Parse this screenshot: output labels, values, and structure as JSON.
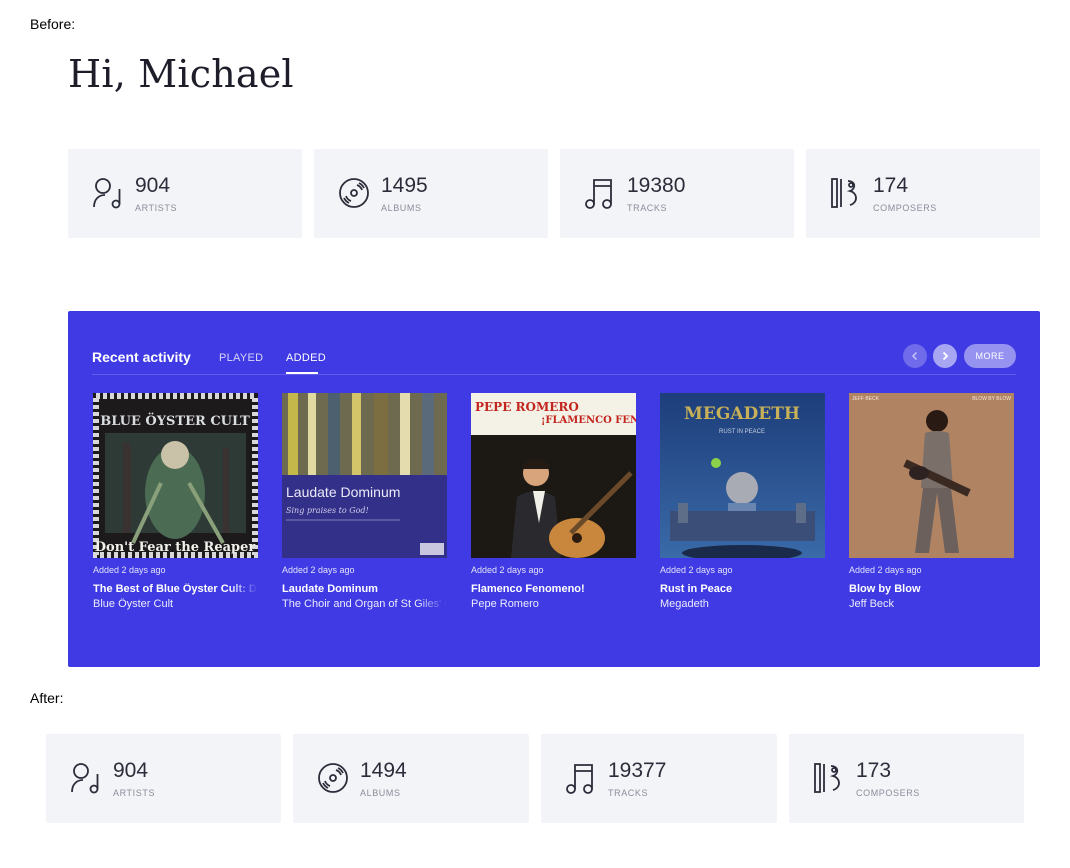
{
  "labels": {
    "before": "Before:",
    "after": "After:"
  },
  "greeting": "Hi, Michael",
  "stats_before": [
    {
      "icon": "artist-icon",
      "value": "904",
      "label": "ARTISTS"
    },
    {
      "icon": "album-disc-icon",
      "value": "1495",
      "label": "ALBUMS"
    },
    {
      "icon": "music-note-icon",
      "value": "19380",
      "label": "TRACKS"
    },
    {
      "icon": "composer-icon",
      "value": "174",
      "label": "COMPOSERS"
    }
  ],
  "stats_after": [
    {
      "icon": "artist-icon",
      "value": "904",
      "label": "ARTISTS"
    },
    {
      "icon": "album-disc-icon",
      "value": "1494",
      "label": "ALBUMS"
    },
    {
      "icon": "music-note-icon",
      "value": "19377",
      "label": "TRACKS"
    },
    {
      "icon": "composer-icon",
      "value": "173",
      "label": "COMPOSERS"
    }
  ],
  "activity": {
    "title": "Recent activity",
    "tabs": [
      "PLAYED",
      "ADDED"
    ],
    "active_tab": "ADDED",
    "prev_icon": "chevron-left-icon",
    "next_icon": "chevron-right-icon",
    "more_label": "MORE",
    "accent_color": "#3f3ae3",
    "albums": [
      {
        "added": "Added 2 days ago",
        "title": "The Best of Blue Öyster Cult: Don't Fear the Reaper",
        "artist": "Blue Öyster Cult",
        "cover_text": [
          "BLUE ÖYSTER CULT",
          "Don't Fear the Reaper"
        ]
      },
      {
        "added": "Added 2 days ago",
        "title": "Laudate Dominum",
        "artist": "The Choir and Organ of St Giles' Cathedral, Edinburgh",
        "cover_text": [
          "Laudate Dominum",
          "Sing praises to God!"
        ]
      },
      {
        "added": "Added 2 days ago",
        "title": "Flamenco Fenomeno!",
        "artist": "Pepe Romero",
        "cover_text": [
          "PEPE ROMERO",
          "¡FLAMENCO FENOMENO!"
        ]
      },
      {
        "added": "Added 2 days ago",
        "title": "Rust in Peace",
        "artist": "Megadeth",
        "cover_text": [
          "MEGADETH",
          "RUST IN PEACE"
        ]
      },
      {
        "added": "Added 2 days ago",
        "title": "Blow by Blow",
        "artist": "Jeff Beck",
        "cover_text": [
          "JEFF BECK",
          "BLOW BY BLOW"
        ]
      }
    ]
  }
}
